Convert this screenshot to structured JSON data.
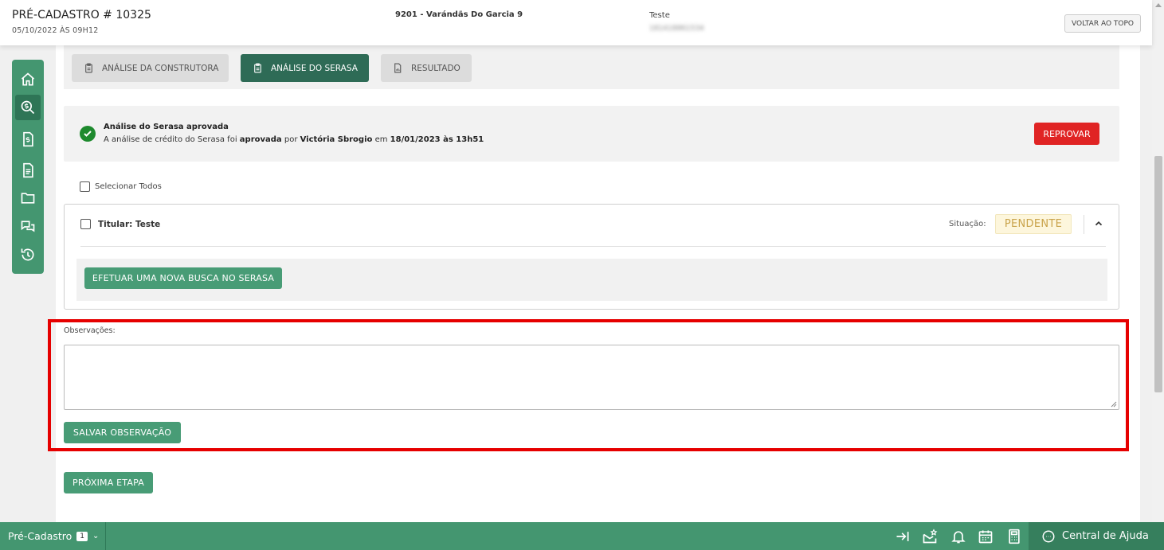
{
  "header": {
    "title": "PRÉ-CADASTRO # 10325",
    "datetime": "05/10/2022 ÀS 09H12",
    "project": "9201 - Varándãs Do Garcia 9",
    "client_name": "Teste",
    "client_doc": "181418861534",
    "back_to_top": "VOLTAR AO TOPO"
  },
  "sidebar": {
    "items": [
      {
        "icon": "home-icon"
      },
      {
        "icon": "search-money-icon",
        "active": true
      },
      {
        "icon": "invoice-icon"
      },
      {
        "icon": "document-icon"
      },
      {
        "icon": "folder-icon"
      },
      {
        "icon": "chat-icon"
      },
      {
        "icon": "history-icon"
      }
    ]
  },
  "tabs": [
    {
      "label": "ANÁLISE DA CONSTRUTORA",
      "active": false
    },
    {
      "label": "ANÁLISE DO SERASA",
      "active": true
    },
    {
      "label": "RESULTADO",
      "active": false
    }
  ],
  "alert": {
    "title": "Análise do Serasa aprovada",
    "text_prefix": "A análise de crédito do Serasa foi ",
    "status_word": "aprovada",
    "text_by": " por ",
    "user": "Victória Sbrogio",
    "text_on": " em ",
    "when": "18/01/2023 às 13h51",
    "reject_label": "REPROVAR"
  },
  "select_all_label": "Selecionar Todos",
  "holder": {
    "label": "Titular: Teste",
    "situation_label": "Situação:",
    "situation_value": "PENDENTE",
    "search_button": "EFETUAR UMA NOVA BUSCA NO SERASA"
  },
  "observations": {
    "label": "Observações:",
    "value": "",
    "save_button": "SALVAR OBSERVAÇÃO"
  },
  "next_step_button": "PRÓXIMA ETAPA",
  "footer": {
    "tab_label": "Pré-Cadastro",
    "tab_count": "1",
    "help_label": "Central de Ajuda"
  },
  "colors": {
    "brand_green": "#449670",
    "dark_green": "#2e6b56",
    "reject_red": "#e02424",
    "pending_text": "#c9a34a",
    "highlight": "#e60000"
  }
}
